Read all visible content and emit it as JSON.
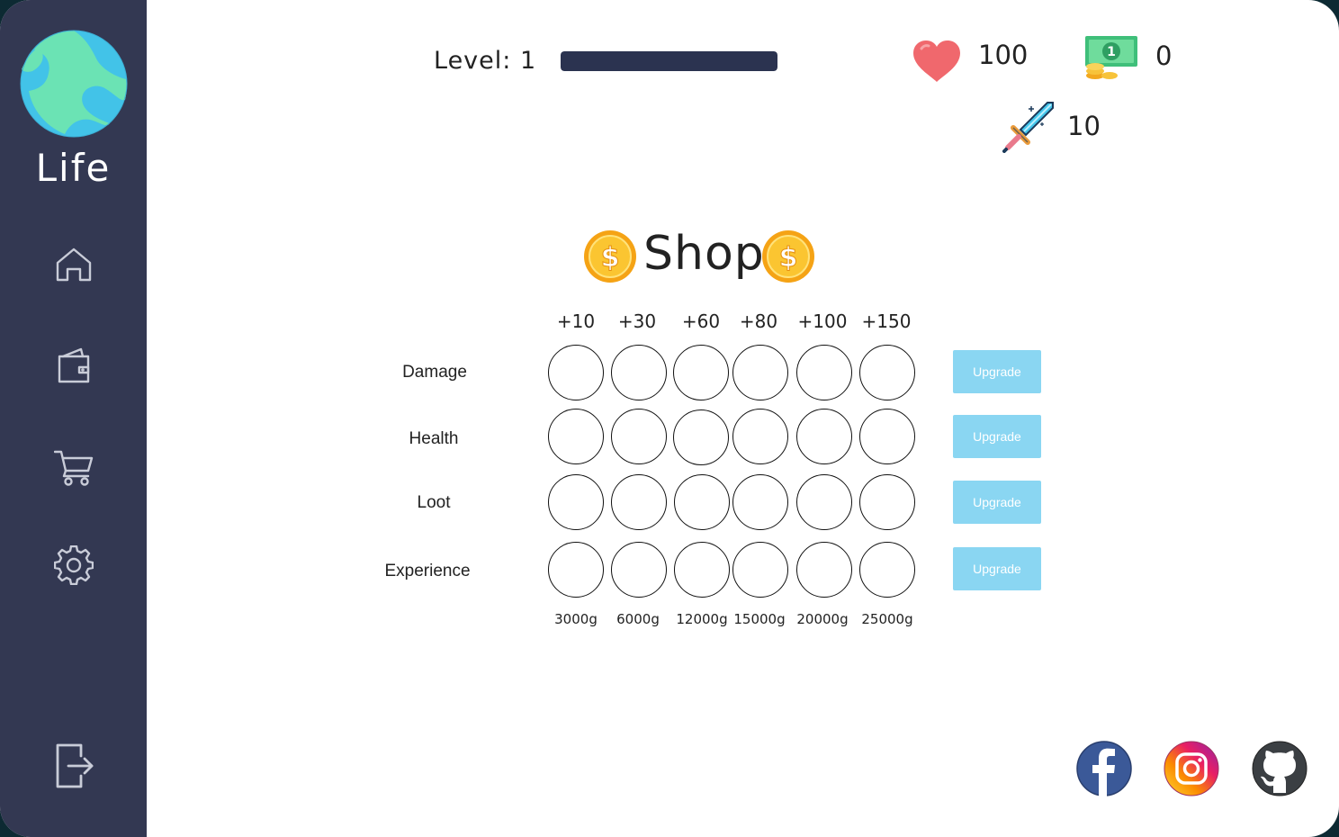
{
  "app": {
    "name": "Life"
  },
  "nav": [
    {
      "icon": "home-icon"
    },
    {
      "icon": "wallet-icon"
    },
    {
      "icon": "cart-icon"
    },
    {
      "icon": "gear-icon"
    },
    {
      "icon": "logout-icon"
    }
  ],
  "header": {
    "level_label": "Level:",
    "level_value": "1",
    "xp_progress": 1.0,
    "health": "100",
    "money": "0",
    "damage": "10"
  },
  "shop": {
    "title": "Shop",
    "tiers": [
      "+10",
      "+30",
      "+60",
      "+80",
      "+100",
      "+150"
    ],
    "prices": [
      "3000g",
      "6000g",
      "12000g",
      "15000g",
      "20000g",
      "25000g"
    ],
    "rows": [
      {
        "label": "Damage",
        "button": "Upgrade"
      },
      {
        "label": "Health",
        "button": "Upgrade"
      },
      {
        "label": "Loot",
        "button": "Upgrade"
      },
      {
        "label": "Experience",
        "button": "Upgrade"
      }
    ]
  },
  "social": [
    "facebook-icon",
    "instagram-icon",
    "github-icon"
  ],
  "colors": {
    "sidebar": "#333852",
    "xp_bar": "#2b3350",
    "upgrade_button": "#8ad6f2",
    "heart": "#f0686d"
  }
}
